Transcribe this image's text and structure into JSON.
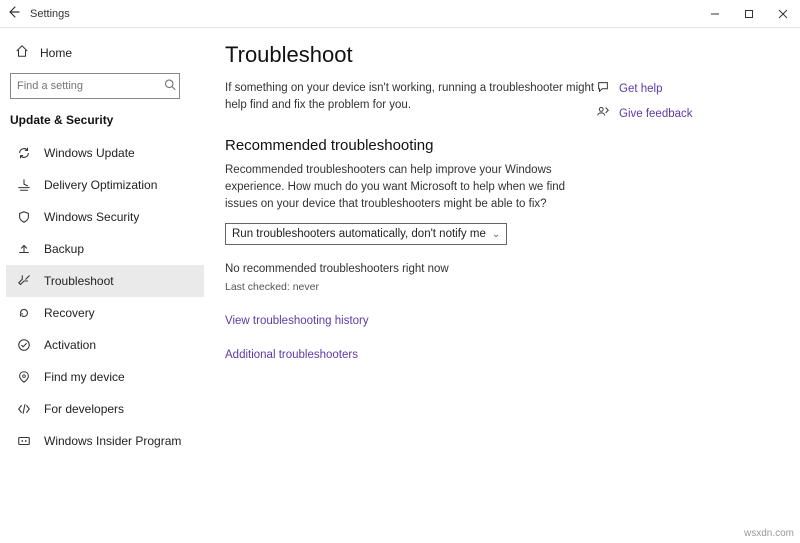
{
  "titlebar": {
    "title": "Settings"
  },
  "sidebar": {
    "home": "Home",
    "search_placeholder": "Find a setting",
    "section": "Update & Security",
    "items": [
      {
        "label": "Windows Update"
      },
      {
        "label": "Delivery Optimization"
      },
      {
        "label": "Windows Security"
      },
      {
        "label": "Backup"
      },
      {
        "label": "Troubleshoot"
      },
      {
        "label": "Recovery"
      },
      {
        "label": "Activation"
      },
      {
        "label": "Find my device"
      },
      {
        "label": "For developers"
      },
      {
        "label": "Windows Insider Program"
      }
    ]
  },
  "main": {
    "title": "Troubleshoot",
    "desc": "If something on your device isn't working, running a troubleshooter might help find and fix the problem for you.",
    "sub_head": "Recommended troubleshooting",
    "sub_desc": "Recommended troubleshooters can help improve your Windows experience. How much do you want Microsoft to help when we find issues on your device that troubleshooters might be able to fix?",
    "dropdown_value": "Run troubleshooters automatically, don't notify me",
    "status": "No recommended troubleshooters right now",
    "last_checked": "Last checked: never",
    "link_history": "View troubleshooting history",
    "link_additional": "Additional troubleshooters"
  },
  "help": {
    "get_help": "Get help",
    "give_feedback": "Give feedback"
  },
  "watermark": "wsxdn.com"
}
